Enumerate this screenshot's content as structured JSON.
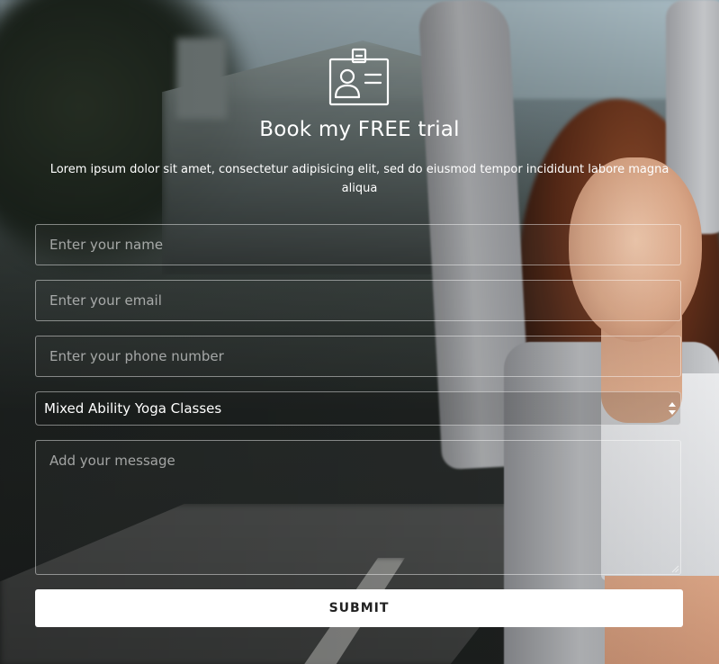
{
  "form": {
    "title": "Book my FREE trial",
    "subtitle": "Lorem ipsum dolor sit amet, consectetur adipisicing elit, sed do eiusmod tempor incididunt labore magna aliqua",
    "icon": "id-card-icon",
    "fields": {
      "name_placeholder": "Enter your name",
      "email_placeholder": "Enter your email",
      "phone_placeholder": "Enter your phone number",
      "class_select_value": "Mixed Ability Yoga Classes",
      "message_placeholder": "Add your message"
    },
    "submit_label": "SUBMIT"
  },
  "colors": {
    "text": "#ffffff",
    "button_bg": "#ffffff",
    "button_text": "#222222",
    "field_border": "rgba(255,255,255,0.45)"
  }
}
